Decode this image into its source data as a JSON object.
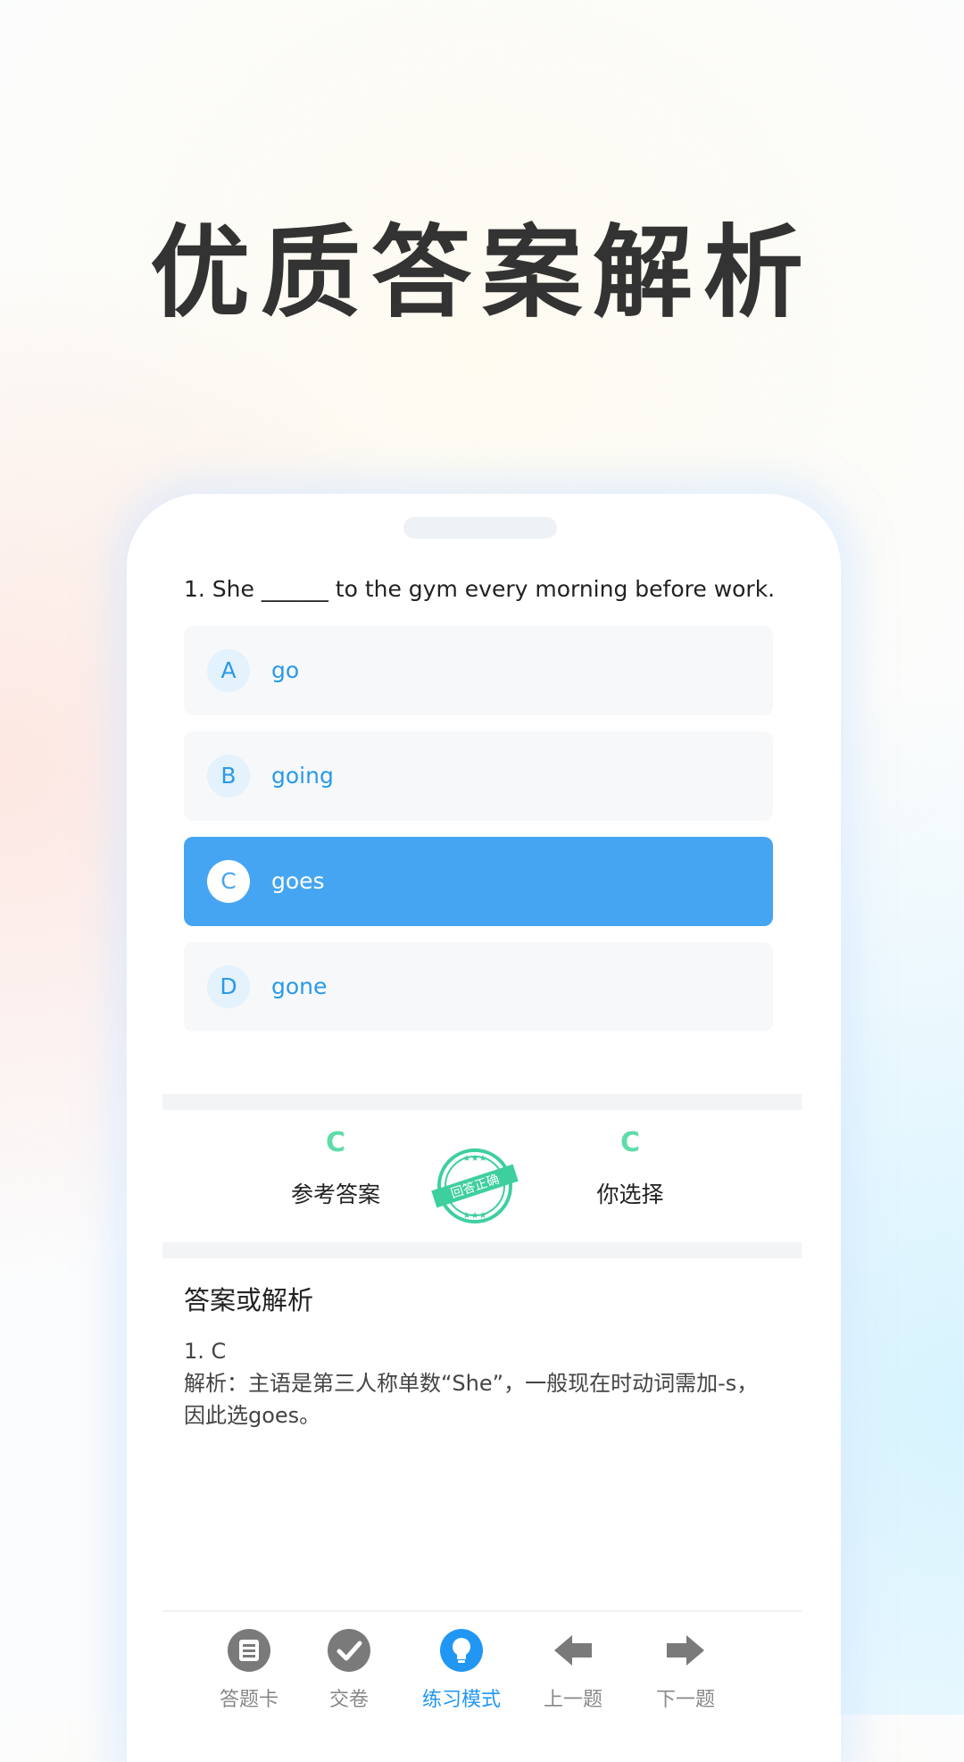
{
  "headline": "优质答案解析",
  "question": "1. She ______ to the gym every morning before work.",
  "options": [
    {
      "letter": "A",
      "text": "go"
    },
    {
      "letter": "B",
      "text": "going"
    },
    {
      "letter": "C",
      "text": "goes"
    },
    {
      "letter": "D",
      "text": "gone"
    }
  ],
  "selected_option": "C",
  "result": {
    "reference_answer": "C",
    "reference_label": "参考答案",
    "your_answer": "C",
    "your_label": "你选择",
    "stamp_text": "回答正确"
  },
  "analysis": {
    "title": "答案或解析",
    "line1": "1. C",
    "line2": "解析：主语是第三人称单数“She”，一般现在时动词需加-s，因此选goes。"
  },
  "nav": {
    "items": [
      {
        "label": "答题卡",
        "icon": "list-icon"
      },
      {
        "label": "交卷",
        "icon": "check-icon"
      },
      {
        "label": "练习模式",
        "icon": "lightbulb-icon"
      },
      {
        "label": "上一题",
        "icon": "arrow-left-icon"
      },
      {
        "label": "下一题",
        "icon": "arrow-right-icon"
      }
    ],
    "active": "练习模式"
  },
  "colors": {
    "accent": "#45a5f2",
    "correct": "#5fdcaa",
    "nav_active": "#2196f3",
    "nav_inactive": "#888888"
  }
}
